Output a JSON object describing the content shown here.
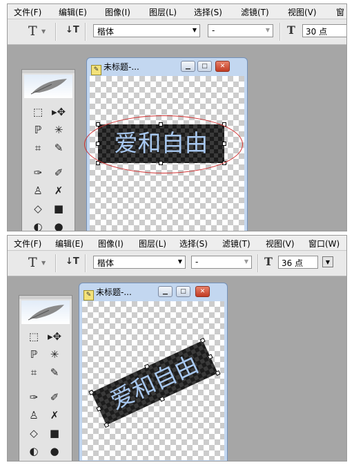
{
  "menu": [
    "文件(F)",
    "编辑(E)",
    "图像(I)",
    "图层(L)",
    "选择(S)",
    "滤镜(T)",
    "视图(V)",
    "窗口(W)"
  ],
  "menu_top_cut": "窗",
  "options": {
    "tool_glyph": "T",
    "orient_glyph": "↓T",
    "font_family": "楷体",
    "font_style": "-",
    "size_glyph": "T"
  },
  "top": {
    "font_size": "30 点",
    "doc_title": "未标题-...",
    "text": "爱和自由"
  },
  "bottom": {
    "font_size": "36 点",
    "doc_title": "未标题-...",
    "text": "爱和自由"
  },
  "window_buttons": {
    "minimize": "▁",
    "maximize": "□",
    "close": "✕"
  },
  "toolbox_tools": [
    "⬚",
    "▸✥",
    "ℙ",
    "✳",
    "⌗",
    "✎",
    "✑",
    "✐",
    "♙",
    "✗",
    "◇",
    "■",
    "◐",
    "●"
  ],
  "annotation_color": "#d03030"
}
